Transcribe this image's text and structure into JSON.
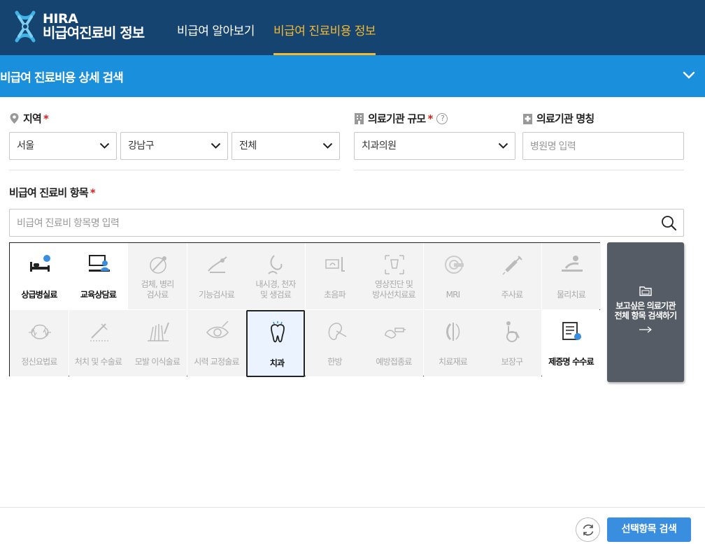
{
  "header": {
    "logo_line1": "HIRA",
    "logo_line2": "비급여진료비 정보",
    "nav": [
      {
        "label": "비급여 알아보기",
        "active": false
      },
      {
        "label": "비급여 진료비용 정보",
        "active": true
      }
    ]
  },
  "search_panel": {
    "title": "비급여 진료비용 상세 검색"
  },
  "region": {
    "label": "지역",
    "required_mark": "*",
    "selects": [
      "서울",
      "강남구",
      "전체"
    ]
  },
  "institution_scale": {
    "label": "의료기관 규모",
    "required_mark": "*",
    "help_mark": "?",
    "selected": "치과의원"
  },
  "institution_name": {
    "label": "의료기관 명칭",
    "placeholder": "병원명 입력"
  },
  "items": {
    "label": "비급여 진료비 항목",
    "required_mark": "*",
    "placeholder": "비급여 진료비 항목명 입력",
    "categories": [
      {
        "label1": "상급병실료",
        "label2": "",
        "icon": "hospital-bed-icon",
        "state": "on"
      },
      {
        "label1": "교육상담료",
        "label2": "",
        "icon": "counseling-icon",
        "state": "on"
      },
      {
        "label1": "검체, 병리",
        "label2": "검사료",
        "icon": "specimen-icon",
        "state": "off"
      },
      {
        "label1": "기능검사료",
        "label2": "",
        "icon": "function-test-icon",
        "state": "off"
      },
      {
        "label1": "내시경, 천자",
        "label2": "및 생검료",
        "icon": "endoscope-icon",
        "state": "off"
      },
      {
        "label1": "초음파",
        "label2": "",
        "icon": "ultrasound-icon",
        "state": "off"
      },
      {
        "label1": "영상진단 및",
        "label2": "방사선치료료",
        "icon": "xray-icon",
        "state": "off"
      },
      {
        "label1": "MRI",
        "label2": "",
        "icon": "mri-icon",
        "state": "off"
      },
      {
        "label1": "주사료",
        "label2": "",
        "icon": "syringe-icon",
        "state": "off"
      },
      {
        "label1": "물리치료",
        "label2": "",
        "icon": "physical-therapy-icon",
        "state": "off"
      },
      {
        "label1": "정신요법료",
        "label2": "",
        "icon": "brain-icon",
        "state": "off"
      },
      {
        "label1": "처치 및 수술료",
        "label2": "",
        "icon": "surgery-icon",
        "state": "off"
      },
      {
        "label1": "모발 이식술료",
        "label2": "",
        "icon": "hair-transplant-icon",
        "state": "off"
      },
      {
        "label1": "시력 교정술료",
        "label2": "",
        "icon": "eye-icon",
        "state": "off"
      },
      {
        "label1": "치과",
        "label2": "",
        "icon": "tooth-icon",
        "state": "selected"
      },
      {
        "label1": "한방",
        "label2": "",
        "icon": "acupuncture-ear-icon",
        "state": "off"
      },
      {
        "label1": "예방접종료",
        "label2": "",
        "icon": "vaccine-icon",
        "state": "off"
      },
      {
        "label1": "치료재료",
        "label2": "",
        "icon": "treatment-material-icon",
        "state": "off"
      },
      {
        "label1": "보장구",
        "label2": "",
        "icon": "wheelchair-icon",
        "state": "off"
      },
      {
        "label1": "제증명 수수료",
        "label2": "",
        "icon": "certificate-icon",
        "state": "on"
      }
    ],
    "all_button_line1": "보고싶은 의료기관",
    "all_button_line2": "전체 항목 검색하기"
  },
  "footer": {
    "submit_label": "선택항목 검색"
  }
}
